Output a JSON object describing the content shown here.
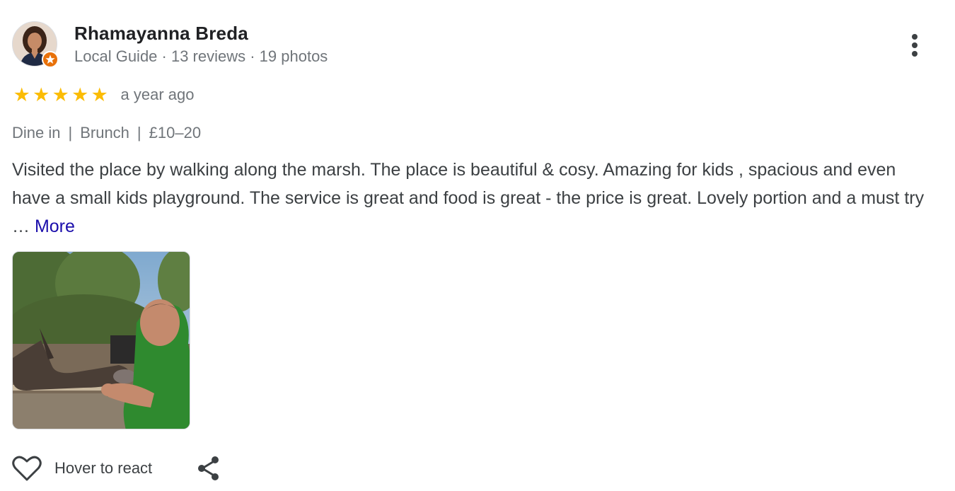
{
  "author": {
    "name": "Rhamayanna Breda",
    "meta": "Local Guide · 13 reviews · 19 photos",
    "avatar_icon": "profile-photo",
    "badge_icon": "local-guide-star-icon",
    "badge_color": "#e8710a"
  },
  "rating": {
    "stars": 5,
    "max": 5,
    "star_glyph": "★",
    "star_color": "#fbbc04",
    "time_ago": "a year ago"
  },
  "attributes": {
    "service": "Dine in",
    "meal": "Brunch",
    "price": "£10–20",
    "separator": "|"
  },
  "review": {
    "text": "Visited the place by walking along the marsh. The place is beautiful & cosy. Amazing for kids , spacious and even have a small kids playground. The service is great and food is great - the price is great. Lovely portion and a must try … ",
    "more_label": "More",
    "link_color": "#1a0dab"
  },
  "photos": [
    {
      "subject": "man feeding donkey photo"
    }
  ],
  "actions": {
    "react_label": "Hover to react",
    "react_icon": "heart-outline-icon",
    "share_icon": "share-icon",
    "menu_icon": "more-vert-icon"
  }
}
